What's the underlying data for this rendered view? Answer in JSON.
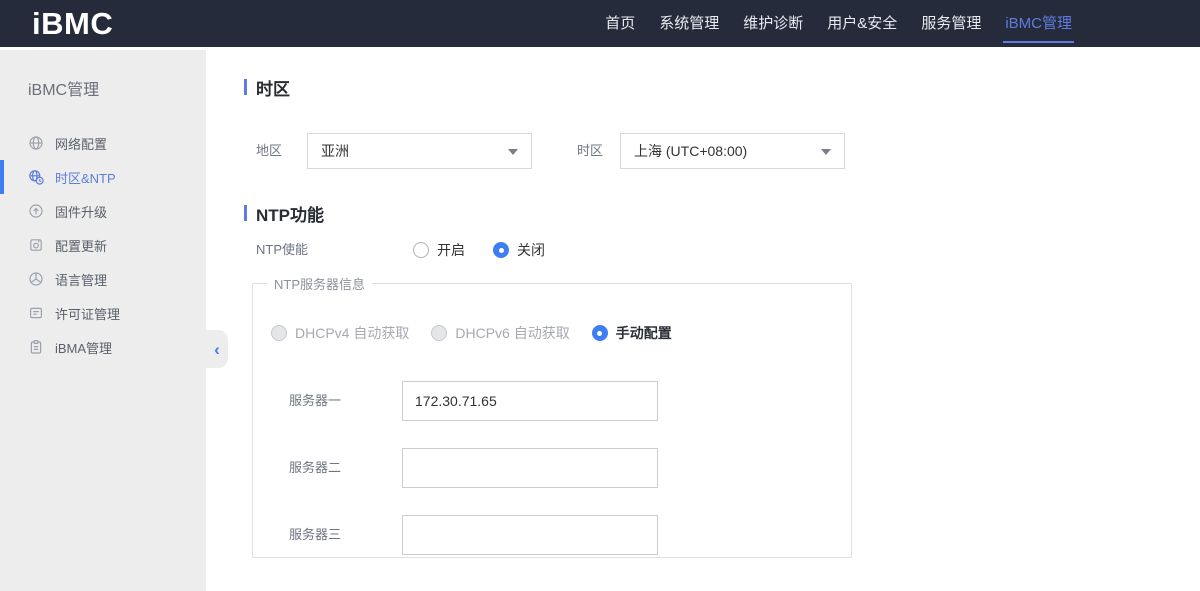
{
  "navbar": {
    "logo": "iBMC",
    "items": [
      {
        "label": "首页",
        "active": false
      },
      {
        "label": "系统管理",
        "active": false
      },
      {
        "label": "维护诊断",
        "active": false
      },
      {
        "label": "用户&安全",
        "active": false
      },
      {
        "label": "服务管理",
        "active": false
      },
      {
        "label": "iBMC管理",
        "active": true
      }
    ]
  },
  "sidebar": {
    "title": "iBMC管理",
    "items": [
      {
        "label": "网络配置",
        "icon": "network-globe-icon",
        "active": false
      },
      {
        "label": "时区&NTP",
        "icon": "timezone-clock-icon",
        "active": true
      },
      {
        "label": "固件升级",
        "icon": "firmware-upgrade-icon",
        "active": false
      },
      {
        "label": "配置更新",
        "icon": "config-update-icon",
        "active": false
      },
      {
        "label": "语言管理",
        "icon": "language-icon",
        "active": false
      },
      {
        "label": "许可证管理",
        "icon": "license-icon",
        "active": false
      },
      {
        "label": "iBMA管理",
        "icon": "ibma-clipboard-icon",
        "active": false
      }
    ],
    "collapse_icon": "‹"
  },
  "main": {
    "timezone": {
      "title": "时区",
      "region_label": "地区",
      "region_value": "亚洲",
      "zone_label": "时区",
      "zone_value": "上海 (UTC+08:00)"
    },
    "ntp": {
      "title": "NTP功能",
      "enable_label": "NTP使能",
      "enable_on": {
        "label": "开启",
        "selected": false
      },
      "enable_off": {
        "label": "关闭",
        "selected": true
      },
      "group_legend": "NTP服务器信息",
      "mode_dhcpv4": {
        "label": "DHCPv4 自动获取",
        "state": "disabled"
      },
      "mode_dhcpv6": {
        "label": "DHCPv6 自动获取",
        "state": "disabled"
      },
      "mode_manual": {
        "label": "手动配置",
        "state": "selected"
      },
      "server1_label": "服务器一",
      "server1_value": "172.30.71.65",
      "server2_label": "服务器二",
      "server2_value": "",
      "server3_label": "服务器三",
      "server3_value": ""
    }
  },
  "colors": {
    "navbar_bg": "#252b3a",
    "accent_blue": "#5e7ce0",
    "radio_checked_blue": "#3f7df2",
    "sidebar_bg": "#ededed"
  }
}
